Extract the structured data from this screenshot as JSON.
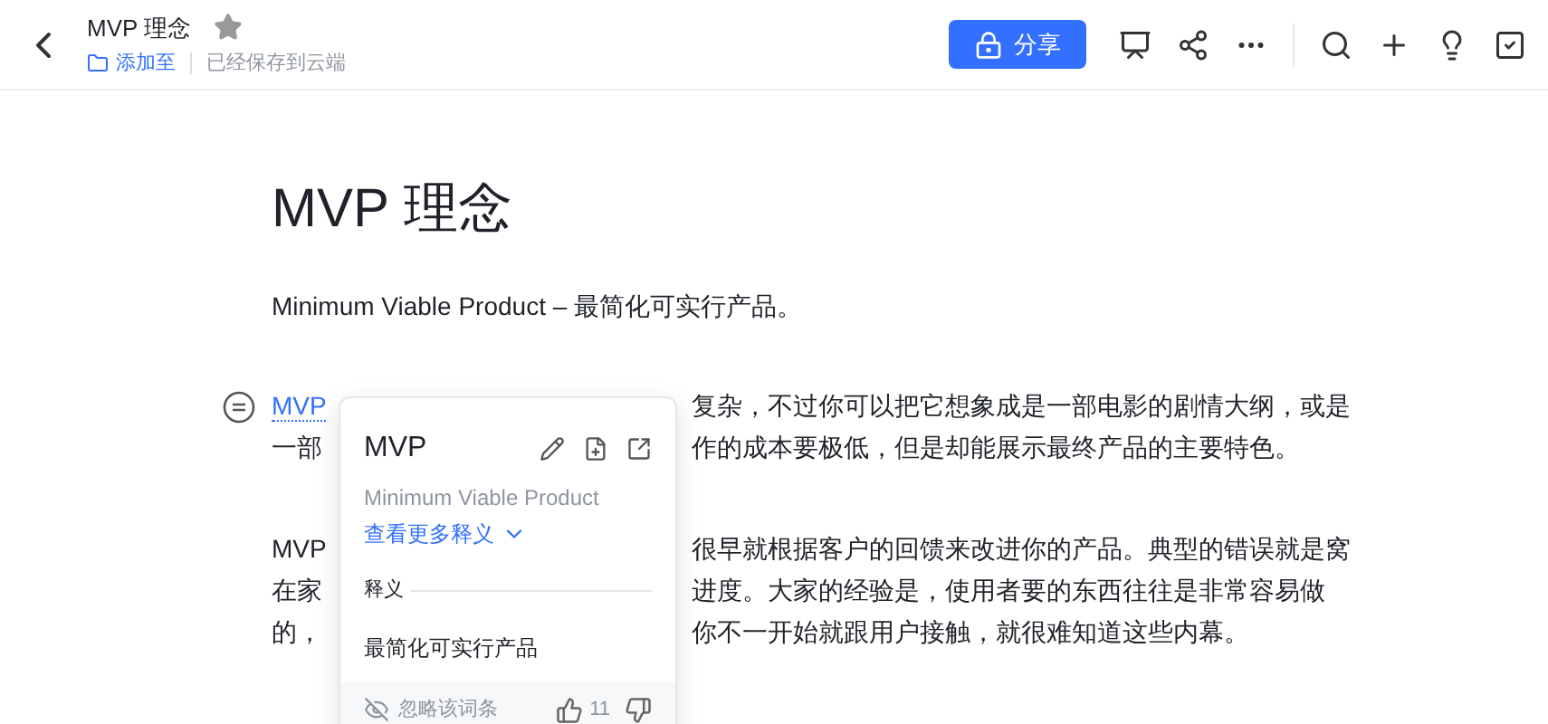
{
  "header": {
    "title": "MVP 理念",
    "add_to": "添加至",
    "save_status": "已经保存到云端",
    "share_button": "分享"
  },
  "document": {
    "title": "MVP 理念",
    "subtitle": "Minimum Viable Product – 最简化可实行产品。",
    "paragraphs": [
      {
        "lines": [
          {
            "left": "MVP",
            "left_term": true,
            "right": "复杂，不过你可以把它想象成是一部电影的剧情大纲，或是"
          },
          {
            "left": "一部",
            "left_term": false,
            "right": "作的成本要极低，但是却能展示最终产品的主要特色。"
          }
        ]
      },
      {
        "lines": [
          {
            "left": "MVP",
            "left_term": false,
            "right": "很早就根据客户的回馈来改进你的产品。典型的错误就是窝"
          },
          {
            "left": "在家",
            "left_term": false,
            "right": "进度。大家的经验是，使用者要的东西往往是非常容易做"
          },
          {
            "left": "的，",
            "left_term": false,
            "right": "你不一开始就跟用户接触，就很难知道这些内幕。"
          }
        ]
      }
    ]
  },
  "popup": {
    "term": "MVP",
    "full_name": "Minimum Viable Product",
    "more_link": "查看更多释义",
    "section_label": "释义",
    "definition": "最简化可实行产品",
    "ignore": "忽略该词条",
    "like_count": "11"
  }
}
